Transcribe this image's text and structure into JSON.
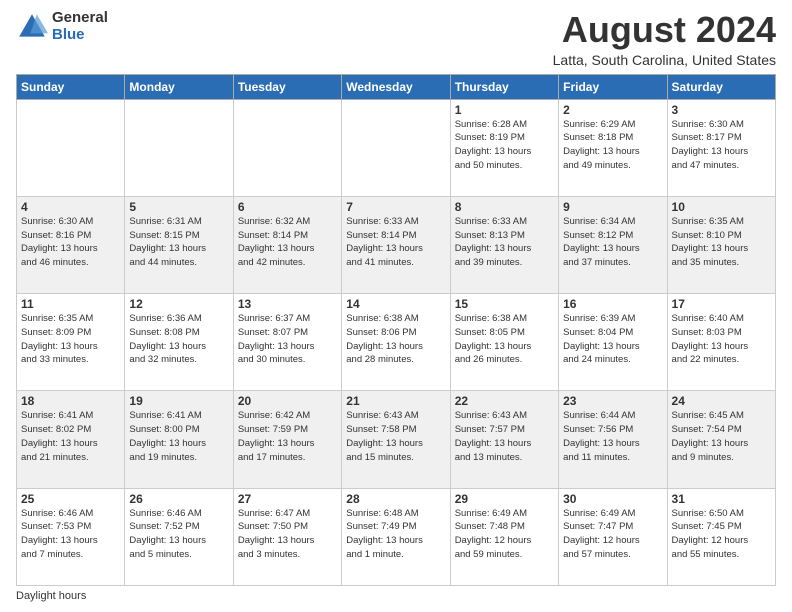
{
  "logo": {
    "general": "General",
    "blue": "Blue"
  },
  "title": "August 2024",
  "subtitle": "Latta, South Carolina, United States",
  "days_header": [
    "Sunday",
    "Monday",
    "Tuesday",
    "Wednesday",
    "Thursday",
    "Friday",
    "Saturday"
  ],
  "footer": "Daylight hours",
  "weeks": [
    [
      {
        "num": "",
        "info": ""
      },
      {
        "num": "",
        "info": ""
      },
      {
        "num": "",
        "info": ""
      },
      {
        "num": "",
        "info": ""
      },
      {
        "num": "1",
        "info": "Sunrise: 6:28 AM\nSunset: 8:19 PM\nDaylight: 13 hours\nand 50 minutes."
      },
      {
        "num": "2",
        "info": "Sunrise: 6:29 AM\nSunset: 8:18 PM\nDaylight: 13 hours\nand 49 minutes."
      },
      {
        "num": "3",
        "info": "Sunrise: 6:30 AM\nSunset: 8:17 PM\nDaylight: 13 hours\nand 47 minutes."
      }
    ],
    [
      {
        "num": "4",
        "info": "Sunrise: 6:30 AM\nSunset: 8:16 PM\nDaylight: 13 hours\nand 46 minutes."
      },
      {
        "num": "5",
        "info": "Sunrise: 6:31 AM\nSunset: 8:15 PM\nDaylight: 13 hours\nand 44 minutes."
      },
      {
        "num": "6",
        "info": "Sunrise: 6:32 AM\nSunset: 8:14 PM\nDaylight: 13 hours\nand 42 minutes."
      },
      {
        "num": "7",
        "info": "Sunrise: 6:33 AM\nSunset: 8:14 PM\nDaylight: 13 hours\nand 41 minutes."
      },
      {
        "num": "8",
        "info": "Sunrise: 6:33 AM\nSunset: 8:13 PM\nDaylight: 13 hours\nand 39 minutes."
      },
      {
        "num": "9",
        "info": "Sunrise: 6:34 AM\nSunset: 8:12 PM\nDaylight: 13 hours\nand 37 minutes."
      },
      {
        "num": "10",
        "info": "Sunrise: 6:35 AM\nSunset: 8:10 PM\nDaylight: 13 hours\nand 35 minutes."
      }
    ],
    [
      {
        "num": "11",
        "info": "Sunrise: 6:35 AM\nSunset: 8:09 PM\nDaylight: 13 hours\nand 33 minutes."
      },
      {
        "num": "12",
        "info": "Sunrise: 6:36 AM\nSunset: 8:08 PM\nDaylight: 13 hours\nand 32 minutes."
      },
      {
        "num": "13",
        "info": "Sunrise: 6:37 AM\nSunset: 8:07 PM\nDaylight: 13 hours\nand 30 minutes."
      },
      {
        "num": "14",
        "info": "Sunrise: 6:38 AM\nSunset: 8:06 PM\nDaylight: 13 hours\nand 28 minutes."
      },
      {
        "num": "15",
        "info": "Sunrise: 6:38 AM\nSunset: 8:05 PM\nDaylight: 13 hours\nand 26 minutes."
      },
      {
        "num": "16",
        "info": "Sunrise: 6:39 AM\nSunset: 8:04 PM\nDaylight: 13 hours\nand 24 minutes."
      },
      {
        "num": "17",
        "info": "Sunrise: 6:40 AM\nSunset: 8:03 PM\nDaylight: 13 hours\nand 22 minutes."
      }
    ],
    [
      {
        "num": "18",
        "info": "Sunrise: 6:41 AM\nSunset: 8:02 PM\nDaylight: 13 hours\nand 21 minutes."
      },
      {
        "num": "19",
        "info": "Sunrise: 6:41 AM\nSunset: 8:00 PM\nDaylight: 13 hours\nand 19 minutes."
      },
      {
        "num": "20",
        "info": "Sunrise: 6:42 AM\nSunset: 7:59 PM\nDaylight: 13 hours\nand 17 minutes."
      },
      {
        "num": "21",
        "info": "Sunrise: 6:43 AM\nSunset: 7:58 PM\nDaylight: 13 hours\nand 15 minutes."
      },
      {
        "num": "22",
        "info": "Sunrise: 6:43 AM\nSunset: 7:57 PM\nDaylight: 13 hours\nand 13 minutes."
      },
      {
        "num": "23",
        "info": "Sunrise: 6:44 AM\nSunset: 7:56 PM\nDaylight: 13 hours\nand 11 minutes."
      },
      {
        "num": "24",
        "info": "Sunrise: 6:45 AM\nSunset: 7:54 PM\nDaylight: 13 hours\nand 9 minutes."
      }
    ],
    [
      {
        "num": "25",
        "info": "Sunrise: 6:46 AM\nSunset: 7:53 PM\nDaylight: 13 hours\nand 7 minutes."
      },
      {
        "num": "26",
        "info": "Sunrise: 6:46 AM\nSunset: 7:52 PM\nDaylight: 13 hours\nand 5 minutes."
      },
      {
        "num": "27",
        "info": "Sunrise: 6:47 AM\nSunset: 7:50 PM\nDaylight: 13 hours\nand 3 minutes."
      },
      {
        "num": "28",
        "info": "Sunrise: 6:48 AM\nSunset: 7:49 PM\nDaylight: 13 hours\nand 1 minute."
      },
      {
        "num": "29",
        "info": "Sunrise: 6:49 AM\nSunset: 7:48 PM\nDaylight: 12 hours\nand 59 minutes."
      },
      {
        "num": "30",
        "info": "Sunrise: 6:49 AM\nSunset: 7:47 PM\nDaylight: 12 hours\nand 57 minutes."
      },
      {
        "num": "31",
        "info": "Sunrise: 6:50 AM\nSunset: 7:45 PM\nDaylight: 12 hours\nand 55 minutes."
      }
    ]
  ]
}
